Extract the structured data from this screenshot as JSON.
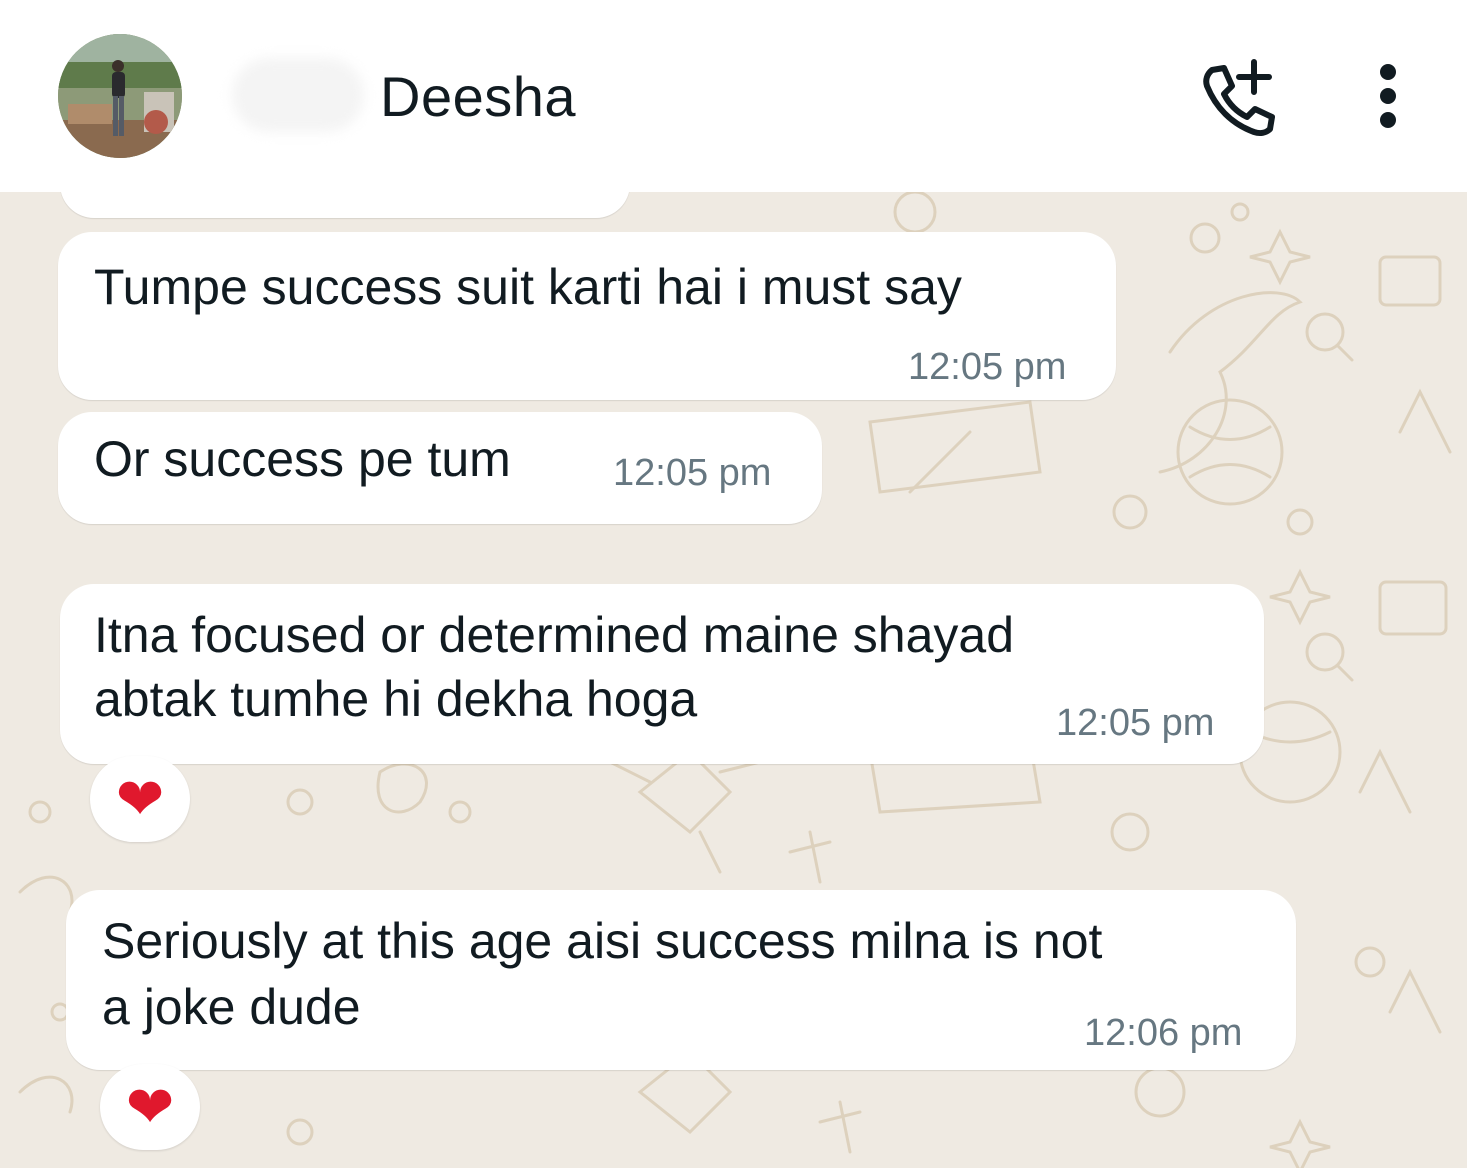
{
  "header": {
    "contact_name": "Deesha",
    "avatar_icon": "profile-photo",
    "call_icon": "add-call-icon",
    "menu_icon": "more-vertical-icon"
  },
  "messages": [
    {
      "lines": [
        "Tumpe success suit karti hai i must say"
      ],
      "time": "12:05 pm",
      "reaction": ""
    },
    {
      "lines": [
        "Or success pe tum"
      ],
      "time": "12:05 pm",
      "reaction": ""
    },
    {
      "lines": [
        "Itna focused or determined maine shayad",
        "abtak tumhe hi dekha hoga"
      ],
      "time": "12:05 pm",
      "reaction": "❤"
    },
    {
      "lines": [
        "Seriously at this age aisi success milna is not",
        "a joke dude"
      ],
      "time": "12:06 pm",
      "reaction": "❤"
    }
  ],
  "colors": {
    "chat_background": "#efeae2",
    "bubble": "#ffffff",
    "timestamp": "#667781",
    "reaction_heart": "#e0182d"
  }
}
